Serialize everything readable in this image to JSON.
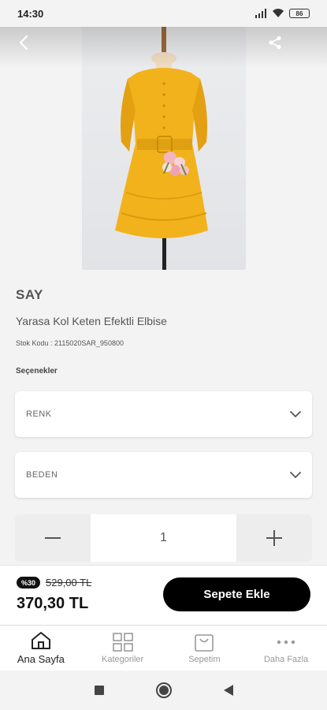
{
  "status": {
    "time": "14:30",
    "battery": "86"
  },
  "product": {
    "brand": "SAY",
    "name": "Yarasa Kol Keten Efektli Elbise",
    "stock_label": "Stok Kodu :",
    "stock_code": "2115020SAR_950800"
  },
  "options": {
    "title": "Seçenekler",
    "color_label": "RENK",
    "size_label": "BEDEN"
  },
  "quantity": {
    "value": "1",
    "minus": "−",
    "plus": "+"
  },
  "price": {
    "discount": "%30",
    "old_price": "529,00 TL",
    "new_price": "370,30 TL",
    "cta": "Sepete Ekle"
  },
  "nav": [
    {
      "label": "Ana Sayfa",
      "icon": "home-icon",
      "active": true
    },
    {
      "label": "Kategoriler",
      "icon": "grid-icon",
      "active": false
    },
    {
      "label": "Sepetim",
      "icon": "bag-icon",
      "active": false
    },
    {
      "label": "Daha Fazla",
      "icon": "more-icon",
      "active": false
    }
  ],
  "colors": {
    "dress": "#f2b21c",
    "accent": "#000000"
  }
}
